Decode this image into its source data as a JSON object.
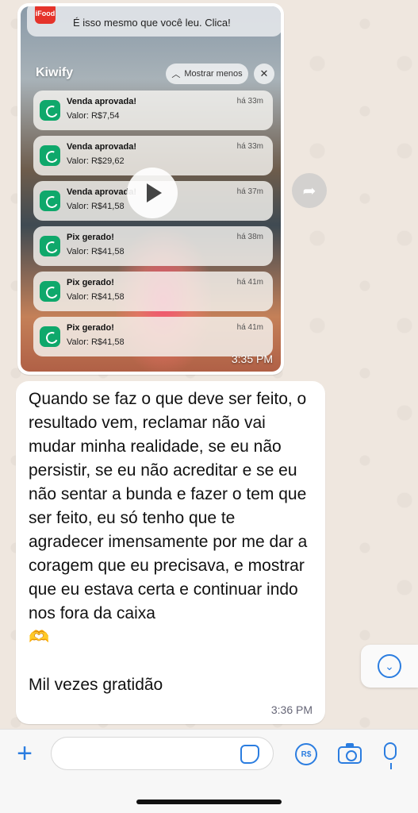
{
  "video_message": {
    "top_notification_text": "É isso mesmo que você leu. Clica!",
    "top_notification_app_badge": "iFood",
    "group_title": "Kiwify",
    "show_less_label": "Mostrar menos",
    "close_glyph": "✕",
    "notifications": [
      {
        "title": "Venda aprovada!",
        "value": "Valor: R$7,54",
        "time": "há 33m"
      },
      {
        "title": "Venda aprovada!",
        "value": "Valor: R$29,62",
        "time": "há 33m"
      },
      {
        "title": "Venda aprovada!",
        "value": "Valor: R$41,58",
        "time": "há 37m"
      },
      {
        "title": "Pix gerado!",
        "value": "Valor: R$41,58",
        "time": "há 38m"
      },
      {
        "title": "Pix gerado!",
        "value": "Valor: R$41,58",
        "time": "há 41m"
      },
      {
        "title": "Pix gerado!",
        "value": "Valor: R$41,58",
        "time": "há 41m"
      }
    ],
    "timestamp": "3:35 PM"
  },
  "text_message": {
    "text": "Quando se faz o que deve ser feito, o resultado vem, reclamar não vai mudar minha realidade, se eu não persistir, se eu não acreditar e se eu não sentar a bunda e fazer o tem que ser feito, eu só tenho que te agradecer imensamente por me dar a coragem que eu precisava, e mostrar que eu estava certa e continuar indo nos fora da caixa\n🫶\n\nMil vezes gratidão",
    "timestamp": "3:36 PM"
  },
  "composer": {
    "placeholder": "",
    "payment_icon_label": "R$"
  },
  "icons": [
    "play-icon",
    "forward-icon",
    "chevron-down-icon",
    "plus-icon",
    "sticker-icon",
    "payment-icon",
    "camera-icon",
    "microphone-icon"
  ],
  "colors": {
    "accent": "#2b7de0",
    "kiwify_green": "#0fa86b",
    "chat_background": "#efe7df"
  }
}
